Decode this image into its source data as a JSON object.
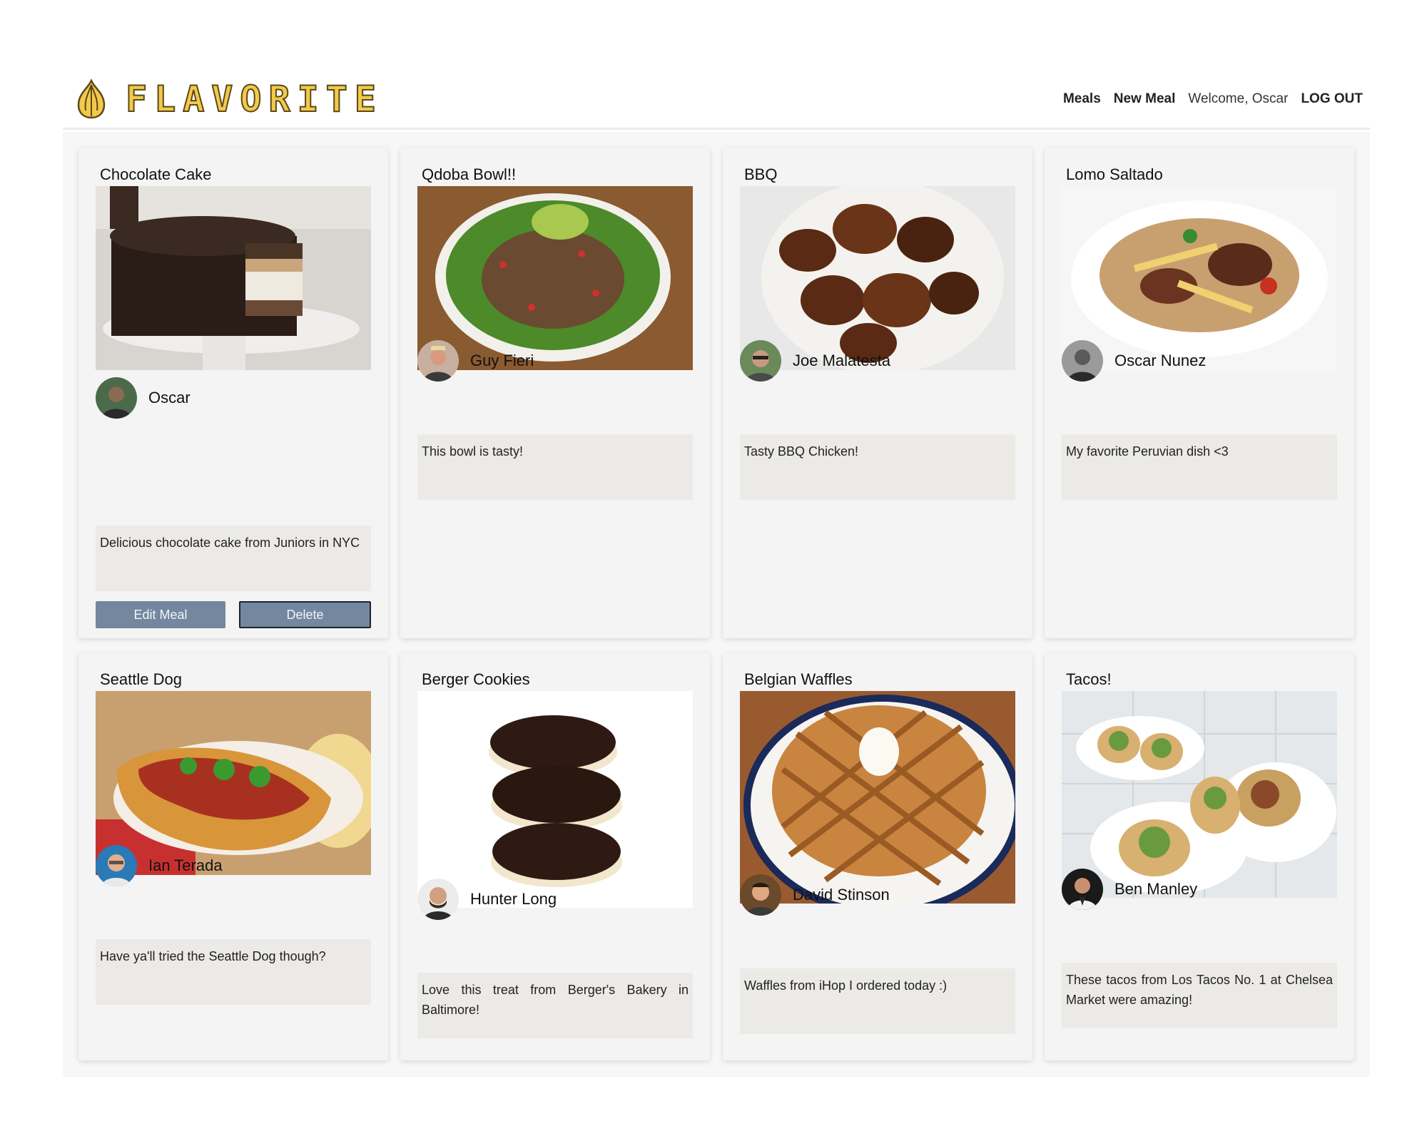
{
  "app": {
    "name": "FLAVORITE"
  },
  "nav": {
    "meals": "Meals",
    "new_meal": "New Meal",
    "welcome": "Welcome, Oscar",
    "logout": "LOG OUT"
  },
  "actions": {
    "edit": "Edit Meal",
    "delete": "Delete"
  },
  "meals": [
    {
      "title": "Chocolate Cake",
      "author": "Oscar",
      "description": "Delicious chocolate cake from Juniors in NYC",
      "image_icon": "chocolate-cake-image"
    },
    {
      "title": "Qdoba Bowl!!",
      "author": "Guy Fieri",
      "description": "This bowl is tasty!",
      "image_icon": "salad-bowl-image"
    },
    {
      "title": "BBQ",
      "author": "Joe Malatesta",
      "description": "Tasty BBQ Chicken!",
      "image_icon": "bbq-chicken-image"
    },
    {
      "title": "Lomo Saltado",
      "author": "Oscar Nunez",
      "description": "My favorite Peruvian dish <3",
      "image_icon": "lomo-saltado-image"
    },
    {
      "title": "Seattle Dog",
      "author": "Ian Terada",
      "description": "Have ya'll tried the Seattle Dog though?",
      "image_icon": "hot-dog-image"
    },
    {
      "title": "Berger Cookies",
      "author": "Hunter Long",
      "description": "Love this treat from Berger's Bakery in Baltimore!",
      "image_icon": "cookies-image"
    },
    {
      "title": "Belgian Waffles",
      "author": "David Stinson",
      "description": "Waffles from iHop I ordered today :)",
      "image_icon": "waffle-image"
    },
    {
      "title": "Tacos!",
      "author": "Ben Manley",
      "description": "These tacos from Los Tacos No. 1 at Chelsea Market were amazing!",
      "image_icon": "tacos-image"
    }
  ]
}
